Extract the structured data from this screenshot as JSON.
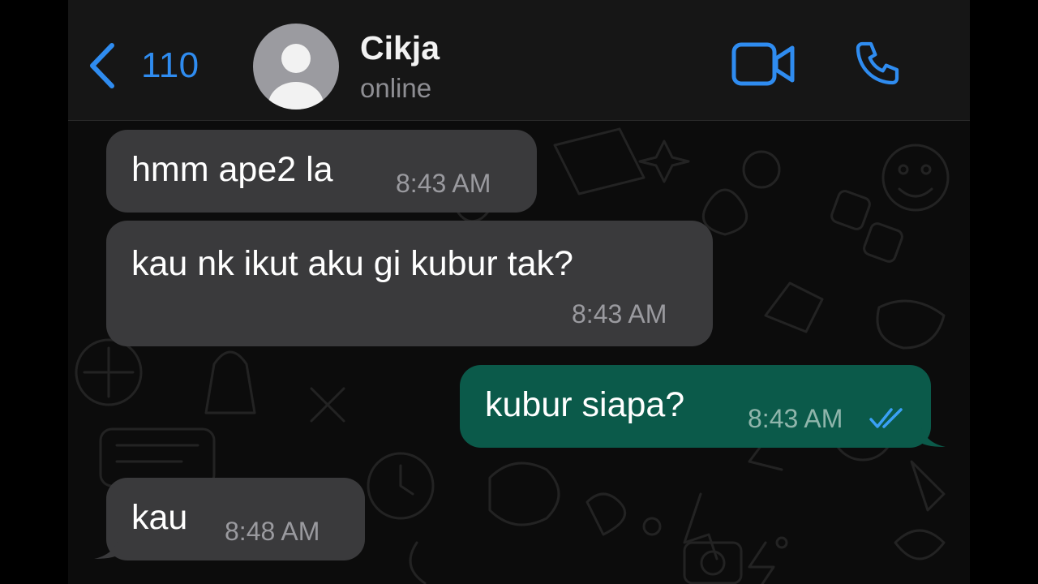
{
  "header": {
    "back_count": "110",
    "contact_name": "Cikja",
    "contact_status": "online"
  },
  "icons": {
    "back": "chevron-left-icon",
    "avatar": "person-icon",
    "video": "video-camera-icon",
    "call": "phone-icon",
    "read_receipt": "double-check-icon"
  },
  "colors": {
    "accent": "#2f8cf0",
    "incoming_bubble": "#3a3a3c",
    "outgoing_bubble": "#0b5a4a",
    "header_bg": "#161616",
    "chat_bg": "#0c0c0c"
  },
  "messages": [
    {
      "direction": "incoming",
      "text": "hmm ape2 la",
      "time": "8:43 AM"
    },
    {
      "direction": "incoming",
      "text": "kau nk ikut aku gi kubur tak?",
      "time": "8:43 AM"
    },
    {
      "direction": "outgoing",
      "text": "kubur siapa?",
      "time": "8:43 AM",
      "status": "read"
    },
    {
      "direction": "incoming",
      "text": "kau",
      "time": "8:48 AM"
    }
  ]
}
